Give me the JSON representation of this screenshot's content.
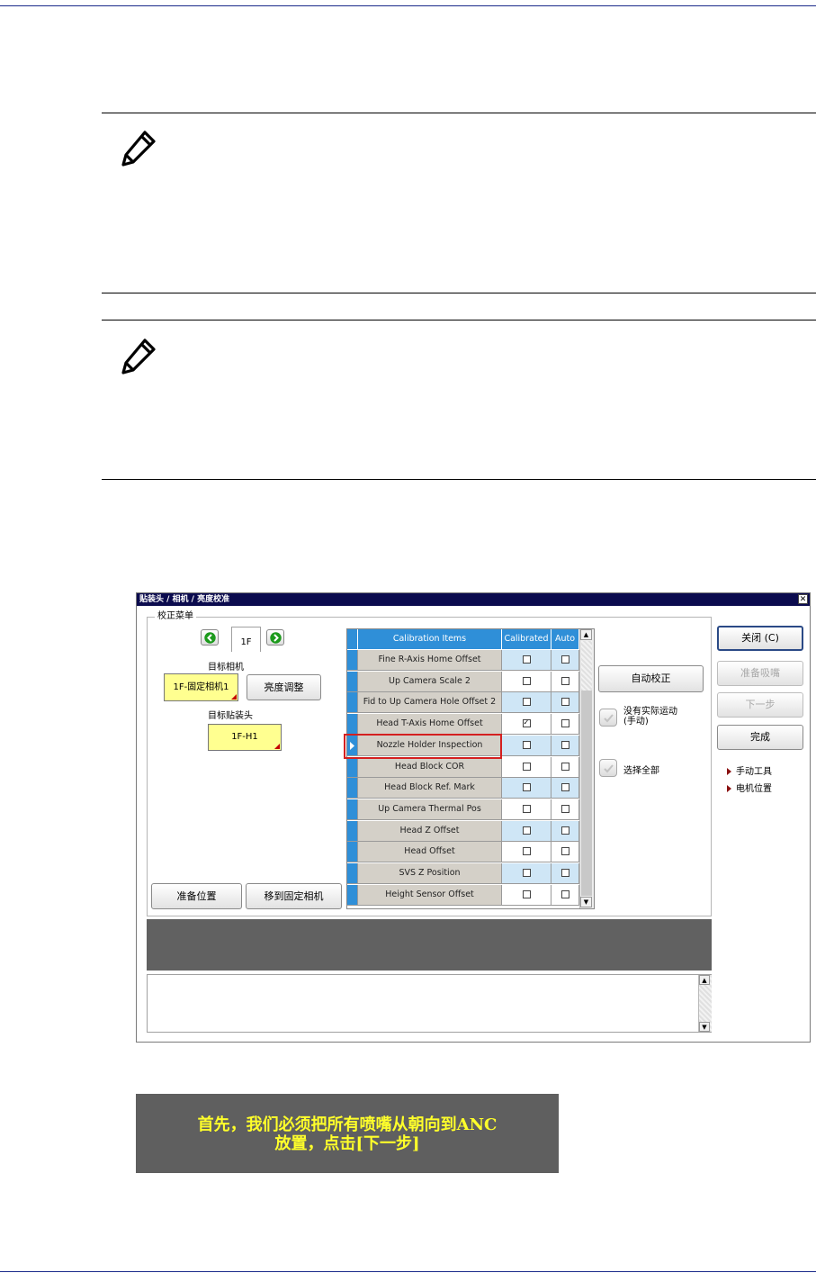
{
  "dialog": {
    "title": "贴装头 / 相机 / 亮度校准",
    "close_glyph": "✕",
    "group_label": "校正菜单",
    "head_tab": "1F",
    "target_camera_label": "目标相机",
    "target_camera_value": "1F-固定相机1",
    "brightness_button": "亮度调整",
    "target_head_label": "目标贴装头",
    "target_head_value": "1F-H1",
    "ready_position_button": "准备位置",
    "move_to_fixed_camera_button": "移到固定相机",
    "grid": {
      "headers": {
        "name": "Calibration Items",
        "calibrated": "Calibrated",
        "auto": "Auto"
      },
      "rows": [
        {
          "name": "Fine R-Axis Home Offset",
          "calibrated": false,
          "auto": false
        },
        {
          "name": "Up Camera Scale 2",
          "calibrated": false,
          "auto": false
        },
        {
          "name": "Fid to Up Camera Hole Offset 2",
          "calibrated": false,
          "auto": false
        },
        {
          "name": "Head T-Axis Home Offset",
          "calibrated": true,
          "auto": false
        },
        {
          "name": "Nozzle Holder Inspection",
          "calibrated": false,
          "auto": false,
          "current": true
        },
        {
          "name": "Head Block COR",
          "calibrated": false,
          "auto": false
        },
        {
          "name": "Head Block Ref. Mark",
          "calibrated": false,
          "auto": false
        },
        {
          "name": "Up Camera Thermal Pos",
          "calibrated": false,
          "auto": false
        },
        {
          "name": "Head Z Offset",
          "calibrated": false,
          "auto": false
        },
        {
          "name": "Head Offset",
          "calibrated": false,
          "auto": false
        },
        {
          "name": "SVS Z Position",
          "calibrated": false,
          "auto": false
        },
        {
          "name": "Height Sensor Offset",
          "calibrated": false,
          "auto": false
        }
      ]
    },
    "auto_calibrate_button": "自动校正",
    "no_motion_label_line1": "没有实际运动",
    "no_motion_label_line2": "(手动)",
    "select_all_label": "选择全部",
    "close_button": "关闭 (C)",
    "prepare_nozzle_button": "准备吸嘴",
    "next_button": "下一步",
    "finish_button": "完成",
    "manual_tools_link": "手动工具",
    "motor_position_link": "电机位置"
  },
  "message": {
    "line1": "首先，我们必须把所有喷嘴从朝向到ANC",
    "line2": "放置，点击[下一步]"
  },
  "colors": {
    "title_bar": "#0b0b4e",
    "grid_header": "#2f8fd8",
    "highlight": "#d42020",
    "yellow_field": "#ffff90",
    "message_text": "#ffff2a"
  }
}
